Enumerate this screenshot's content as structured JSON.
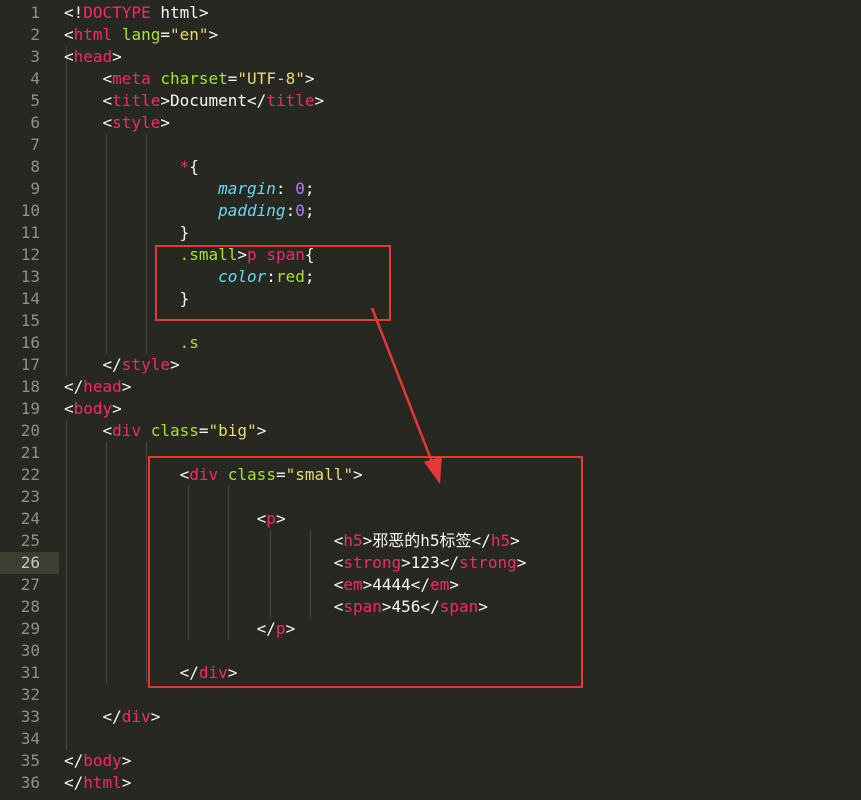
{
  "editor": {
    "active_line": 26,
    "colors": {
      "background": "#272822",
      "text": "#f8f8f2",
      "tag": "#f92672",
      "attr": "#a6e22e",
      "string": "#e6db74",
      "property": "#66d9ef",
      "number": "#ae81ff",
      "gutter": "#90908a",
      "annotation": "#e53935"
    },
    "lines": [
      [
        [
          "punct",
          "<!"
        ],
        [
          "tag",
          "DOCTYPE"
        ],
        [
          "text",
          " html"
        ],
        [
          "punct",
          ">"
        ]
      ],
      [
        [
          "punct",
          "<"
        ],
        [
          "tag",
          "html"
        ],
        [
          "text",
          " "
        ],
        [
          "attr",
          "lang"
        ],
        [
          "punct",
          "="
        ],
        [
          "string",
          "\"en\""
        ],
        [
          "punct",
          ">"
        ]
      ],
      [
        [
          "punct",
          "<"
        ],
        [
          "tag",
          "head"
        ],
        [
          "punct",
          ">"
        ]
      ],
      [
        [
          "text",
          "    "
        ],
        [
          "punct",
          "<"
        ],
        [
          "tag",
          "meta"
        ],
        [
          "text",
          " "
        ],
        [
          "attr",
          "charset"
        ],
        [
          "punct",
          "="
        ],
        [
          "string",
          "\"UTF-8\""
        ],
        [
          "punct",
          ">"
        ]
      ],
      [
        [
          "text",
          "    "
        ],
        [
          "punct",
          "<"
        ],
        [
          "tag",
          "title"
        ],
        [
          "punct",
          ">"
        ],
        [
          "text",
          "Document"
        ],
        [
          "punct",
          "</"
        ],
        [
          "tag",
          "title"
        ],
        [
          "punct",
          ">"
        ]
      ],
      [
        [
          "text",
          "    "
        ],
        [
          "punct",
          "<"
        ],
        [
          "tag",
          "style"
        ],
        [
          "punct",
          ">"
        ]
      ],
      [],
      [
        [
          "text",
          "            "
        ],
        [
          "tag",
          "*"
        ],
        [
          "punct",
          "{"
        ]
      ],
      [
        [
          "text",
          "                "
        ],
        [
          "prop",
          "margin"
        ],
        [
          "punct",
          ": "
        ],
        [
          "num",
          "0"
        ],
        [
          "punct",
          ";"
        ]
      ],
      [
        [
          "text",
          "                "
        ],
        [
          "prop",
          "padding"
        ],
        [
          "punct",
          ":"
        ],
        [
          "num",
          "0"
        ],
        [
          "punct",
          ";"
        ]
      ],
      [
        [
          "text",
          "            "
        ],
        [
          "punct",
          "}"
        ]
      ],
      [
        [
          "text",
          "            "
        ],
        [
          "attr",
          ".small"
        ],
        [
          "punct",
          ">"
        ],
        [
          "tag",
          "p"
        ],
        [
          "text",
          " "
        ],
        [
          "tag",
          "span"
        ],
        [
          "punct",
          "{"
        ]
      ],
      [
        [
          "text",
          "                "
        ],
        [
          "prop",
          "color"
        ],
        [
          "punct",
          ":"
        ],
        [
          "attr",
          "red"
        ],
        [
          "punct",
          ";"
        ]
      ],
      [
        [
          "text",
          "            "
        ],
        [
          "punct",
          "}"
        ]
      ],
      [],
      [
        [
          "text",
          "            "
        ],
        [
          "attr",
          ".s"
        ]
      ],
      [
        [
          "text",
          "    "
        ],
        [
          "punct",
          "</"
        ],
        [
          "tag",
          "style"
        ],
        [
          "punct",
          ">"
        ]
      ],
      [
        [
          "punct",
          "</"
        ],
        [
          "tag",
          "head"
        ],
        [
          "punct",
          ">"
        ]
      ],
      [
        [
          "punct",
          "<"
        ],
        [
          "tag",
          "body"
        ],
        [
          "punct",
          ">"
        ]
      ],
      [
        [
          "text",
          "    "
        ],
        [
          "punct",
          "<"
        ],
        [
          "tag",
          "div"
        ],
        [
          "text",
          " "
        ],
        [
          "attr",
          "class"
        ],
        [
          "punct",
          "="
        ],
        [
          "string",
          "\"big\""
        ],
        [
          "punct",
          ">"
        ]
      ],
      [],
      [
        [
          "text",
          "            "
        ],
        [
          "punct",
          "<"
        ],
        [
          "tag",
          "div"
        ],
        [
          "text",
          " "
        ],
        [
          "attr",
          "class"
        ],
        [
          "punct",
          "="
        ],
        [
          "string",
          "\"small\""
        ],
        [
          "punct",
          ">"
        ]
      ],
      [],
      [
        [
          "text",
          "                    "
        ],
        [
          "punct",
          "<"
        ],
        [
          "tag",
          "p"
        ],
        [
          "punct",
          ">"
        ]
      ],
      [
        [
          "text",
          "                            "
        ],
        [
          "punct",
          "<"
        ],
        [
          "tag",
          "h5"
        ],
        [
          "punct",
          ">"
        ],
        [
          "text",
          "邪恶的h5标签"
        ],
        [
          "punct",
          "</"
        ],
        [
          "tag",
          "h5"
        ],
        [
          "punct",
          ">"
        ]
      ],
      [
        [
          "text",
          "                            "
        ],
        [
          "punct",
          "<"
        ],
        [
          "tag",
          "strong"
        ],
        [
          "punct",
          ">"
        ],
        [
          "text",
          "123"
        ],
        [
          "punct",
          "</"
        ],
        [
          "tag",
          "strong"
        ],
        [
          "punct",
          ">"
        ]
      ],
      [
        [
          "text",
          "                            "
        ],
        [
          "punct",
          "<"
        ],
        [
          "tag",
          "em"
        ],
        [
          "punct",
          ">"
        ],
        [
          "text",
          "4444"
        ],
        [
          "punct",
          "</"
        ],
        [
          "tag",
          "em"
        ],
        [
          "punct",
          ">"
        ]
      ],
      [
        [
          "text",
          "                            "
        ],
        [
          "punct",
          "<"
        ],
        [
          "tag",
          "span"
        ],
        [
          "punct",
          ">"
        ],
        [
          "text",
          "456"
        ],
        [
          "punct",
          "</"
        ],
        [
          "tag",
          "span"
        ],
        [
          "punct",
          ">"
        ]
      ],
      [
        [
          "text",
          "                    "
        ],
        [
          "punct",
          "</"
        ],
        [
          "tag",
          "p"
        ],
        [
          "punct",
          ">"
        ]
      ],
      [],
      [
        [
          "text",
          "            "
        ],
        [
          "punct",
          "</"
        ],
        [
          "tag",
          "div"
        ],
        [
          "punct",
          ">"
        ]
      ],
      [],
      [
        [
          "text",
          "    "
        ],
        [
          "punct",
          "</"
        ],
        [
          "tag",
          "div"
        ],
        [
          "punct",
          ">"
        ]
      ],
      [],
      [
        [
          "punct",
          "</"
        ],
        [
          "tag",
          "body"
        ],
        [
          "punct",
          ">"
        ]
      ],
      [
        [
          "punct",
          "</"
        ],
        [
          "tag",
          "html"
        ],
        [
          "punct",
          ">"
        ]
      ]
    ]
  }
}
